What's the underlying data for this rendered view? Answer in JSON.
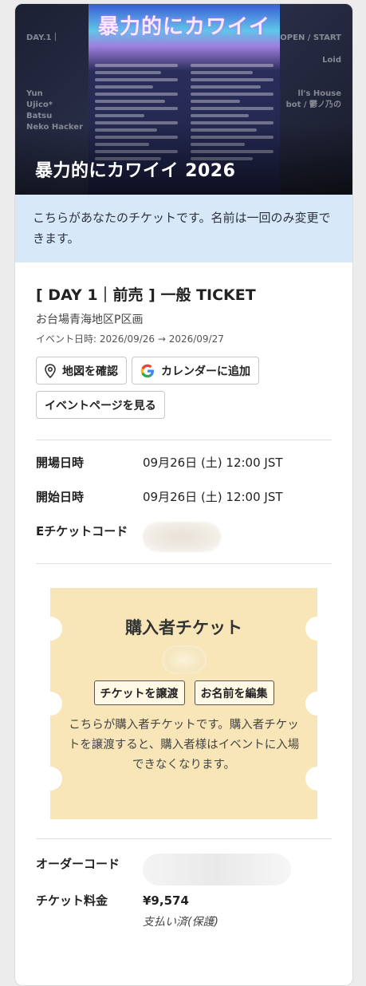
{
  "hero": {
    "event_title": "暴力的にカワイイ 2026",
    "poster_title": "暴力的にカワイイ"
  },
  "notice": "こちらがあなたのチケットです。名前は一回のみ変更できます。",
  "ticket": {
    "title": "[ DAY 1｜前売 ] 一般 TICKET",
    "venue": "お台場青海地区P区画",
    "event_dates": "イベント日時: 2026/09/26 → 2026/09/27"
  },
  "buttons": {
    "map": "地図を確認",
    "calendar": "カレンダーに追加",
    "event_page": "イベントページを見る"
  },
  "details": {
    "open_label": "開場日時",
    "open_value": "09月26日 (土) 12:00 JST",
    "start_label": "開始日時",
    "start_value": "09月26日 (土) 12:00 JST",
    "eticket_label": "Eチケットコード"
  },
  "buyer": {
    "title": "購入者チケット",
    "transfer_button": "チケットを譲渡",
    "edit_name_button": "お名前を編集",
    "description": "こちらが購入者チケットです。購入者チケットを譲渡すると、購入者様はイベントに入場できなくなります。"
  },
  "order": {
    "order_code_label": "オーダーコード",
    "price_label": "チケット料金",
    "price_value": "¥9,574",
    "payment_status": "支払い済(保護)"
  },
  "colors": {
    "notice_bg": "#d7e8f8",
    "buyer_bg": "#f8e6b8"
  }
}
